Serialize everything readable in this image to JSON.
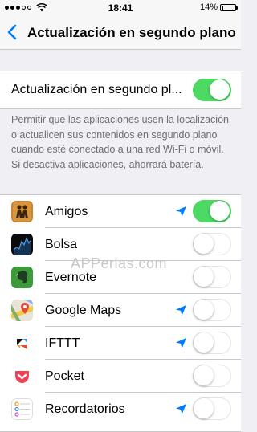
{
  "status_bar": {
    "time": "18:41",
    "battery": "14%",
    "battery_level": 0.14
  },
  "nav": {
    "title": "Actualización en segundo plano"
  },
  "main_setting": {
    "label": "Actualización en segundo pl...",
    "on": true
  },
  "footer": {
    "text": "Permitir que las aplicaciones usen la localización o actualicen sus contenidos en segundo plano cuando esté conectado a una red Wi-Fi o móvil. Si desactiva aplicaciones, ahorrará batería."
  },
  "watermark": "APPerlas.com",
  "apps": [
    {
      "name": "Amigos",
      "icon": "find-friends-icon",
      "location": true,
      "on": true
    },
    {
      "name": "Bolsa",
      "icon": "stocks-icon",
      "location": false,
      "on": false
    },
    {
      "name": "Evernote",
      "icon": "evernote-icon",
      "location": false,
      "on": false
    },
    {
      "name": "Google Maps",
      "icon": "google-maps-icon",
      "location": true,
      "on": false
    },
    {
      "name": "IFTTT",
      "icon": "ifttt-icon",
      "location": true,
      "on": false
    },
    {
      "name": "Pocket",
      "icon": "pocket-icon",
      "location": false,
      "on": false
    },
    {
      "name": "Recordatorios",
      "icon": "reminders-icon",
      "location": true,
      "on": false
    }
  ],
  "colors": {
    "accent": "#007aff",
    "switch_on": "#4cd964",
    "background": "#efeff4"
  }
}
